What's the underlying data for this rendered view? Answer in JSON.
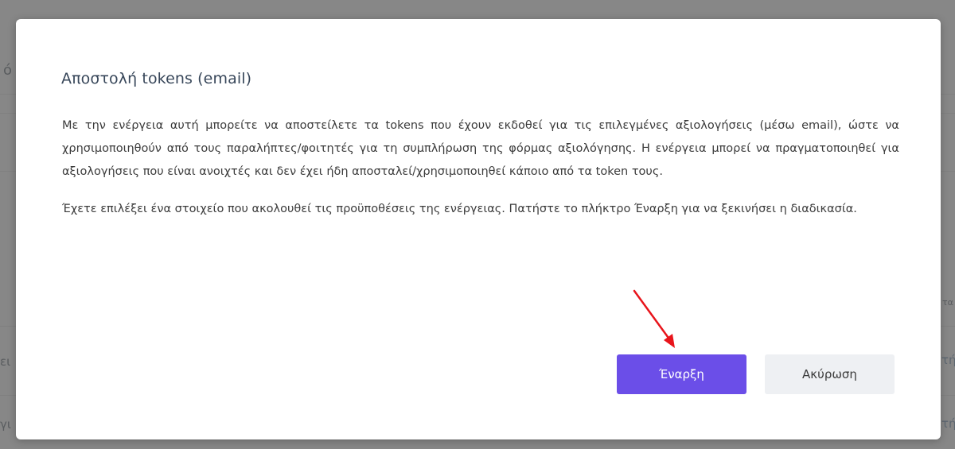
{
  "background": {
    "fragments": [
      "ό",
      "ει",
      "γι",
      "τα",
      "τή",
      "τή"
    ]
  },
  "dialog": {
    "title": "Αποστολή tokens (email)",
    "paragraph_1": "Με την ενέργεια αυτή μπορείτε να αποστείλετε τα tokens που έχουν εκδοθεί για τις επιλεγμένες αξιολογήσεις (μέσω email), ώστε να χρησιμοποιηθούν από τους παραλήπτες/φοιτητές για τη συμπλήρωση της φόρμας αξιολόγησης. Η ενέργεια μπορεί να πραγματοποιηθεί για αξιολογήσεις που είναι ανοιχτές και δεν έχει ήδη αποσταλεί/χρησιμοποιηθεί κάποιο από τα token τους.",
    "paragraph_2": "Έχετε επιλέξει ένα στοιχείο που ακολουθεί τις προϋποθέσεις της ενέργειας. Πατήστε το πλήκτρο Έναρξη για να ξεκινήσει η διαδικασία.",
    "start_label": "Έναρξη",
    "cancel_label": "Ακύρωση"
  },
  "colors": {
    "primary_button": "#6b4ee8",
    "secondary_button": "#eef0f3",
    "annotation_arrow": "#e8141b",
    "overlay": "rgba(95,95,95,0.75)"
  }
}
